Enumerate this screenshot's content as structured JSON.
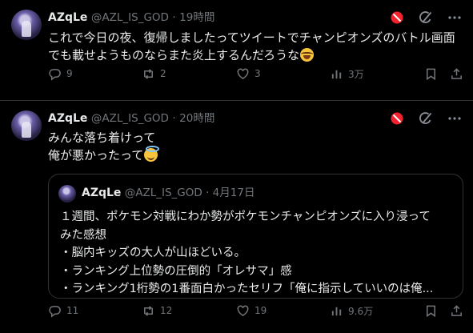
{
  "tweets": [
    {
      "name": "AZqLe",
      "handle": "@AZL_IS_GOD",
      "dot": "·",
      "time": "19時間",
      "lines": [
        "これで今日の夜、復帰しましたってツイートでチャンピオンズのバトル画面",
        "でも載せようものならまた炎上するんだろうな"
      ],
      "emoji": "laughing-tears-emoji",
      "stats": {
        "replies": "9",
        "reposts": "2",
        "likes": "3",
        "views": "3万"
      }
    },
    {
      "name": "AZqLe",
      "handle": "@AZL_IS_GOD",
      "dot": "·",
      "time": "20時間",
      "lines": [
        "みんな落ち着けって",
        "俺が悪かったって"
      ],
      "emoji": "halo-smile-emoji",
      "quote": {
        "name": "AZqLe",
        "handle": "@AZL_IS_GOD",
        "dot": "·",
        "time": "4月17日",
        "lines": [
          "１週間、ポケモン対戦にわか勢がポケモンチャンピオンズに入り浸って",
          "みた感想",
          "・脳内キッズの大人が山ほどいる。",
          "・ランキング上位勢の圧倒的「オレサマ」感",
          "・ランキング1桁勢の1番面白かったセリフ「俺に指示していいのは俺..."
        ]
      },
      "stats": {
        "replies": "11",
        "reposts": "12",
        "likes": "19",
        "views": "9.6万"
      }
    }
  ],
  "colors": {
    "background": "#000000",
    "text": "#e7e9ea",
    "muted": "#71767b",
    "border": "#2f3336",
    "block_red": "#f4212e"
  },
  "icons": [
    "reply-icon",
    "repost-icon",
    "like-icon",
    "views-icon",
    "bookmark-icon",
    "share-icon",
    "block-icon",
    "grok-icon"
  ]
}
